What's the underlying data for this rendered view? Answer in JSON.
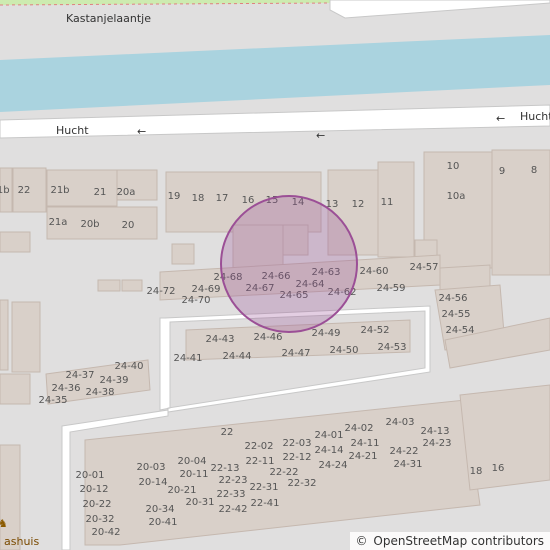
{
  "map": {
    "streets": [
      {
        "name": "Kastanjelaantje"
      },
      {
        "name": "Hucht"
      },
      {
        "name": "Hucht",
        "variant": "right"
      }
    ],
    "house_numbers": [
      "21b",
      "22",
      "21",
      "20a",
      "21a",
      "20b",
      "20",
      "19",
      "18",
      "17",
      "16",
      "15",
      "14",
      "13",
      "12",
      "11",
      "10",
      "10a",
      "9",
      "8",
      "24-68",
      "24-66",
      "24-63",
      "24-60",
      "24-57",
      "24-69",
      "24-67",
      "24-64",
      "24-62",
      "24-59",
      "24-72",
      "24-70",
      "24-65",
      "24-56",
      "24-55",
      "24-54",
      "24-43",
      "24-46",
      "24-49",
      "24-52",
      "24-41",
      "24-44",
      "24-47",
      "24-50",
      "24-53",
      "24-40",
      "24-37",
      "24-39",
      "24-36",
      "24-38",
      "24-35",
      "22",
      "24-03",
      "24-02",
      "24-01",
      "24-13",
      "22-02",
      "22-03",
      "24-11",
      "24-23",
      "20-04",
      "22-11",
      "22-12",
      "24-14",
      "24-21",
      "24-22",
      "20-03",
      "20-11",
      "22-13",
      "22-22",
      "24-24",
      "24-31",
      "20-01",
      "20-14",
      "22-23",
      "22-32",
      "20-12",
      "20-21",
      "22-33",
      "22-31",
      "20-22",
      "20-31",
      "22-42",
      "22-41",
      "20-34",
      "20-32",
      "20-41",
      "20-42",
      "18",
      "16"
    ],
    "poi_partial_label": "ashuis",
    "selection_color": "#9b4f96",
    "colors": {
      "water": "#aad3df",
      "building": "#d9d0c9",
      "road": "#ffffff",
      "park": "#cdebb0"
    }
  },
  "attribution": {
    "copyright_symbol": "©",
    "text": "OpenStreetMap contributors"
  }
}
